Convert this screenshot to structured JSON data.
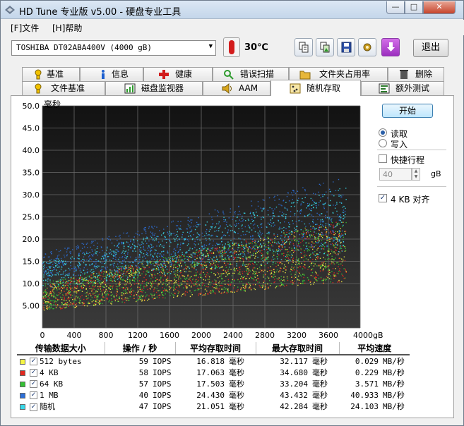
{
  "window": {
    "title": "HD Tune 专业版 v5.00 - 硬盘专业工具",
    "min_icon": "minimize-icon",
    "max_icon": "maximize-icon",
    "close_glyph": "✕"
  },
  "menu": {
    "file": "[F]文件",
    "help": "[H]帮助"
  },
  "toolbar": {
    "drive": "TOSHIBA DT02ABA400V (4000 gB)",
    "temperature": "30℃",
    "exit": "退出",
    "buttons": [
      "copy-text-icon",
      "copy-image-icon",
      "save-icon",
      "settings-icon",
      "download-icon"
    ]
  },
  "tabs_top": [
    {
      "label": "基准",
      "icon": "benchmark-icon",
      "color": "#f2c200"
    },
    {
      "label": "信息",
      "icon": "info-icon",
      "color": "#1c5fcf"
    },
    {
      "label": "健康",
      "icon": "health-icon",
      "color": "#d11b1b"
    },
    {
      "label": "错误扫描",
      "icon": "error-scan-icon",
      "color": "#2c9a2c"
    },
    {
      "label": "文件夹占用率",
      "icon": "folder-icon",
      "color": "#e7b73a"
    },
    {
      "label": "删除",
      "icon": "erase-icon",
      "color": "#555555"
    }
  ],
  "tabs_bottom": [
    {
      "label": "文件基准",
      "icon": "file-benchmark-icon",
      "color": "#f2c200"
    },
    {
      "label": "磁盘监视器",
      "icon": "disk-monitor-icon",
      "color": "#2c9a2c"
    },
    {
      "label": "AAM",
      "icon": "speaker-icon",
      "color": "#d8a61c"
    },
    {
      "label": "随机存取",
      "icon": "random-access-icon",
      "color": "#e7b73a"
    },
    {
      "label": "额外测试",
      "icon": "extra-tests-icon",
      "color": "#2c7a2c"
    }
  ],
  "controls": {
    "start": "开始",
    "read": "读取",
    "write": "写入",
    "mode": "read",
    "short_stroke": "快捷行程",
    "short_stroke_checked": false,
    "short_stroke_value": "40",
    "short_stroke_unit": "gB",
    "align_4kb": "4 KB 对齐",
    "align_4kb_checked": true
  },
  "chart_data": {
    "type": "scatter",
    "ylabel": "毫秒",
    "y_ticks": [
      "50.0",
      "45.0",
      "40.0",
      "35.0",
      "30.0",
      "25.0",
      "20.0",
      "15.0",
      "10.0",
      "5.00"
    ],
    "x_ticks": [
      "0",
      "400",
      "800",
      "1200",
      "1600",
      "2000",
      "2400",
      "2800",
      "3200",
      "3600",
      "4000gB"
    ],
    "xlim": [
      0,
      4000
    ],
    "ylim": [
      0,
      50
    ],
    "grid": true,
    "background": "#1e1e1e",
    "series": [
      {
        "name": "512 bytes",
        "color": "#f5f545",
        "min_ms": 4,
        "max_ms": 32,
        "slope": 0.0038
      },
      {
        "name": "4 KB",
        "color": "#e2291f",
        "min_ms": 4,
        "max_ms": 34.7,
        "slope": 0.0038
      },
      {
        "name": "64 KB",
        "color": "#34c034",
        "min_ms": 4.2,
        "max_ms": 33.2,
        "slope": 0.0038
      },
      {
        "name": "1 MB",
        "color": "#2c6fd8",
        "min_ms": 11,
        "max_ms": 43.4,
        "slope": 0.0045
      },
      {
        "name": "随机",
        "color": "#38d8e8",
        "min_ms": 9,
        "max_ms": 42.3,
        "slope": 0.0044
      }
    ]
  },
  "stats": {
    "headers": [
      "传输数据大小",
      "操作 / 秒",
      "平均存取时间",
      "最大存取时间",
      "平均速度"
    ],
    "rows": [
      {
        "color": "#f5f545",
        "name": "512 bytes",
        "ops": "59",
        "ops_unit": "IOPS",
        "avg": "16.818",
        "avg_unit": "毫秒",
        "max": "32.117",
        "max_unit": "毫秒",
        "speed": "0.029",
        "speed_unit": "MB/秒"
      },
      {
        "color": "#e2291f",
        "name": "4 KB",
        "ops": "58",
        "ops_unit": "IOPS",
        "avg": "17.063",
        "avg_unit": "毫秒",
        "max": "34.680",
        "max_unit": "毫秒",
        "speed": "0.229",
        "speed_unit": "MB/秒"
      },
      {
        "color": "#34c034",
        "name": "64 KB",
        "ops": "57",
        "ops_unit": "IOPS",
        "avg": "17.503",
        "avg_unit": "毫秒",
        "max": "33.204",
        "max_unit": "毫秒",
        "speed": "3.571",
        "speed_unit": "MB/秒"
      },
      {
        "color": "#2c6fd8",
        "name": "1 MB",
        "ops": "40",
        "ops_unit": "IOPS",
        "avg": "24.430",
        "avg_unit": "毫秒",
        "max": "43.432",
        "max_unit": "毫秒",
        "speed": "40.933",
        "speed_unit": "MB/秒"
      },
      {
        "color": "#38d8e8",
        "name": "随机",
        "ops": "47",
        "ops_unit": "IOPS",
        "avg": "21.051",
        "avg_unit": "毫秒",
        "max": "42.284",
        "max_unit": "毫秒",
        "speed": "24.103",
        "speed_unit": "MB/秒"
      }
    ]
  }
}
